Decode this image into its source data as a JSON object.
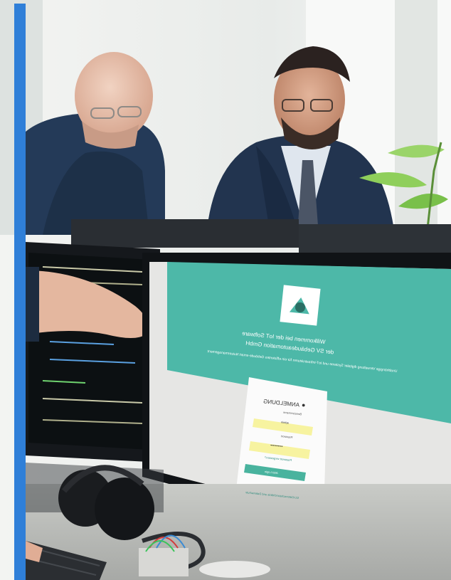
{
  "colors": {
    "accent_bar": "#2f7fd8",
    "wall": "#eef0ee",
    "login_header": "#4db8a8",
    "login_field": "#f7f3a0",
    "login_button": "#49b39e",
    "monitor_bezel": "#15181c",
    "suit": "#22344f"
  },
  "login_screen": {
    "welcome_line1": "Willkommen bei der IoT Software",
    "welcome_line2": "der SV Gebäudeautomation GmbH",
    "welcome_subtitle": "Unabhängige Verwaltung digitaler Systeme und IoT-Infrastrukturen für ein effizientes Gebäude-smart Nutzermanagement",
    "panel_title": "ANMELDUNG",
    "username_label": "Benutzername",
    "username_value": "admin",
    "password_label": "Passwort",
    "password_value": "••••••••••",
    "forgot_link": "Passwort vergessen?",
    "login_button": "Jetzt Login",
    "footer_link": "EU-Datenschutzrichtlinie und Datenschutz",
    "logo_icon": "house-logo-icon",
    "user_icon": "user-icon"
  }
}
